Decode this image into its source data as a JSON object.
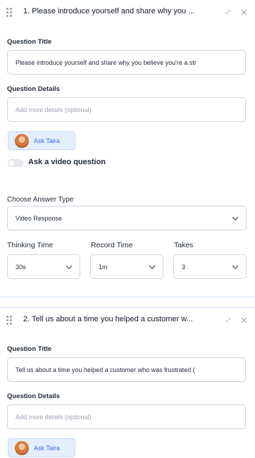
{
  "questions": [
    {
      "title": "1. Please introduce yourself and share why you ...",
      "question_title_label": "Question Title",
      "question_title_value": "Please introduce yourself and share why you believe you're a str",
      "question_details_label": "Question Details",
      "question_details_placeholder": "Add more details (optional)",
      "ask_taira_label": "Ask Taira",
      "video_toggle_label": "Ask a video question",
      "answer_type_label": "Choose Answer Type",
      "answer_type_value": "Video Response",
      "thinking_time_label": "Thinking Time",
      "thinking_time_value": "30s",
      "record_time_label": "Record Time",
      "record_time_value": "1m",
      "takes_label": "Takes",
      "takes_value": "3"
    },
    {
      "title": "2. Tell us about a time you helped a customer w...",
      "question_title_label": "Question Title",
      "question_title_value": "Tell us about a time you helped a customer who was frustrated (",
      "question_details_label": "Question Details",
      "question_details_placeholder": "Add more details (optional)",
      "ask_taira_label": "Ask Taira"
    }
  ],
  "colors": {
    "accent": "#3b6fd8",
    "card_border": "#cfe0f7",
    "taira_bg": "#e4eefc"
  },
  "icons": {
    "drag": "drag-handle-icon",
    "collapse": "collapse-icon",
    "close": "close-icon",
    "chevron": "chevron-down-icon",
    "avatar": "taira-avatar"
  }
}
